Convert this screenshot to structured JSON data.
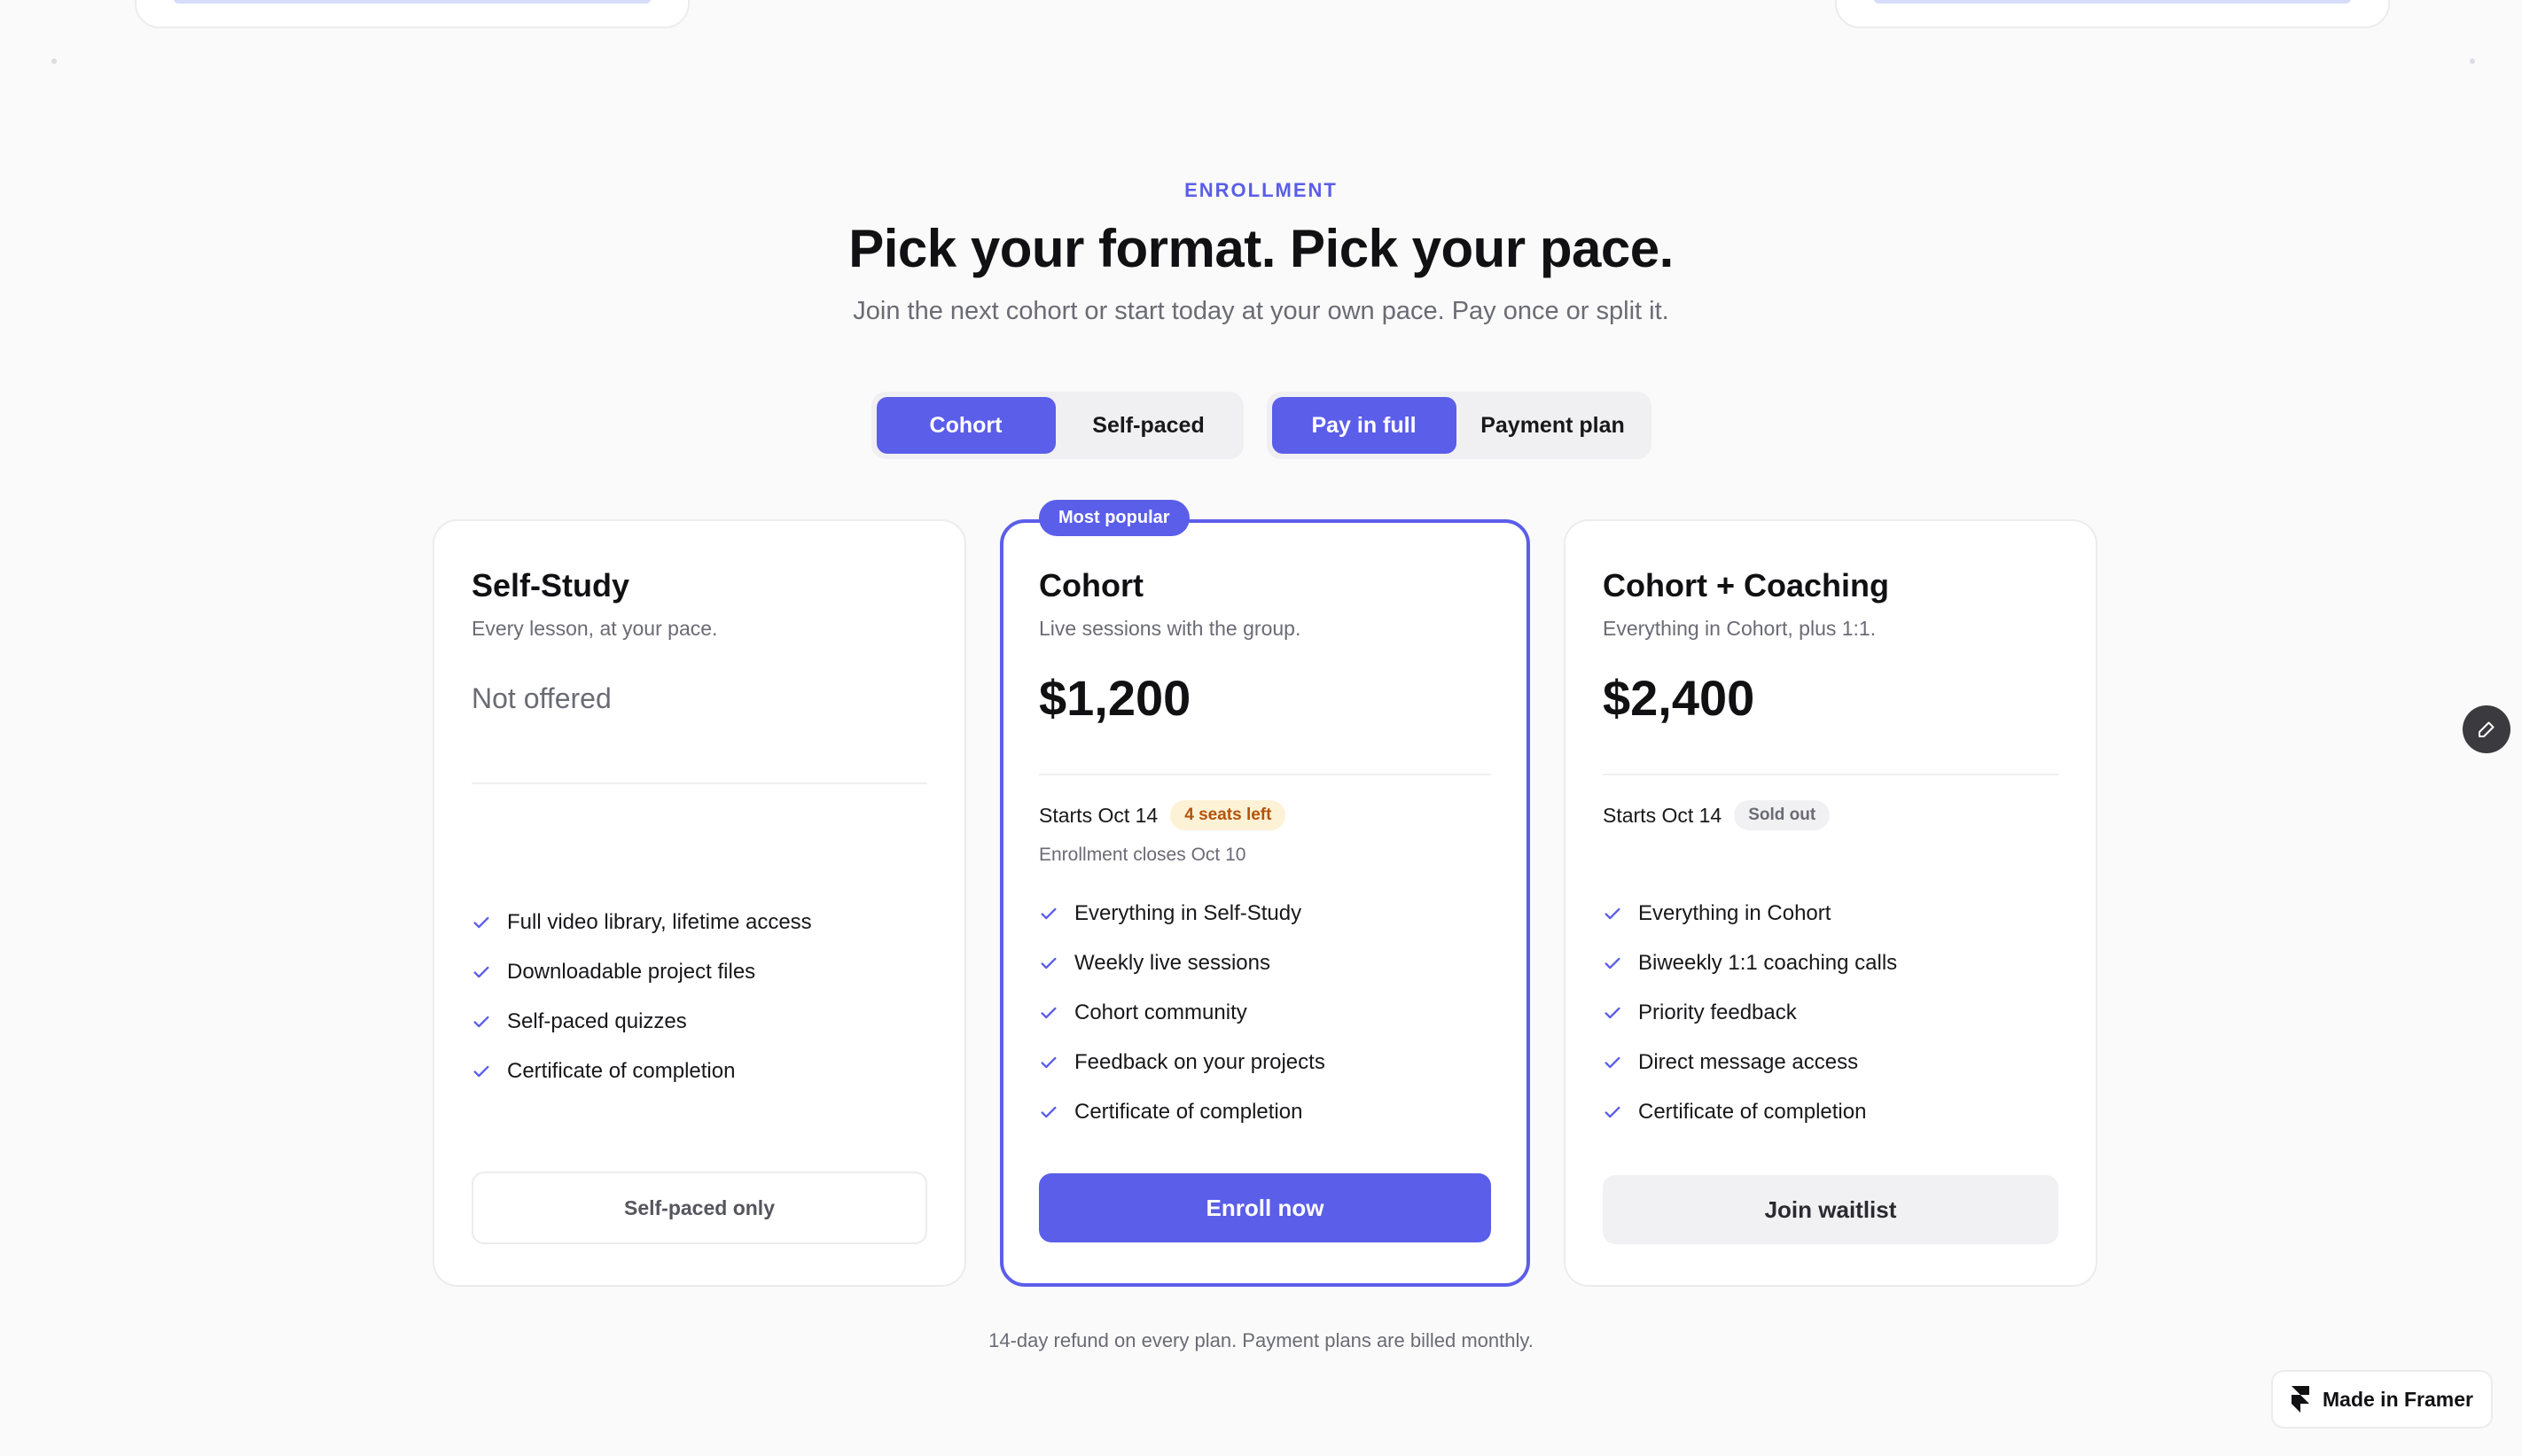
{
  "header": {
    "eyebrow": "ENROLLMENT",
    "title": "Pick your format. Pick your pace.",
    "subtitle": "Join the next cohort or start today at your own pace. Pay once or split it."
  },
  "toggles": {
    "format": {
      "options": [
        "Cohort",
        "Self-paced"
      ],
      "selected": "Cohort"
    },
    "payment": {
      "options": [
        "Pay in full",
        "Payment plan"
      ],
      "selected": "Pay in full"
    }
  },
  "plans": [
    {
      "name": "Self-Study",
      "tagline": "Every lesson, at your pace.",
      "price": "Not offered",
      "features": [
        "Full video library, lifetime access",
        "Downloadable project files",
        "Self-paced quizzes",
        "Certificate of completion"
      ],
      "cta": "Self-paced only"
    },
    {
      "name": "Cohort",
      "badge": "Most popular",
      "tagline": "Live sessions with the group.",
      "price": "$1,200",
      "starts": "Starts Oct 14",
      "status": "4 seats left",
      "note": "Enrollment closes Oct 10",
      "features": [
        "Everything in Self-Study",
        "Weekly live sessions",
        "Cohort community",
        "Feedback on your projects",
        "Certificate of completion"
      ],
      "cta": "Enroll now"
    },
    {
      "name": "Cohort + Coaching",
      "tagline": "Everything in Cohort, plus 1:1.",
      "price": "$2,400",
      "starts": "Starts Oct 14",
      "status": "Sold out",
      "features": [
        "Everything in Cohort",
        "Biweekly 1:1 coaching calls",
        "Priority feedback",
        "Direct message access",
        "Certificate of completion"
      ],
      "cta": "Join waitlist"
    }
  ],
  "footnote": "14-day refund on every plan. Payment plans are billed monthly.",
  "framer_badge": "Made in Framer",
  "colors": {
    "accent": "#5b5ee9",
    "warning_bg": "#fdf1d6",
    "warning_text": "#b45309"
  },
  "icons": {
    "check": "check-icon",
    "edit": "pencil-icon",
    "framer": "framer-logo-icon"
  }
}
